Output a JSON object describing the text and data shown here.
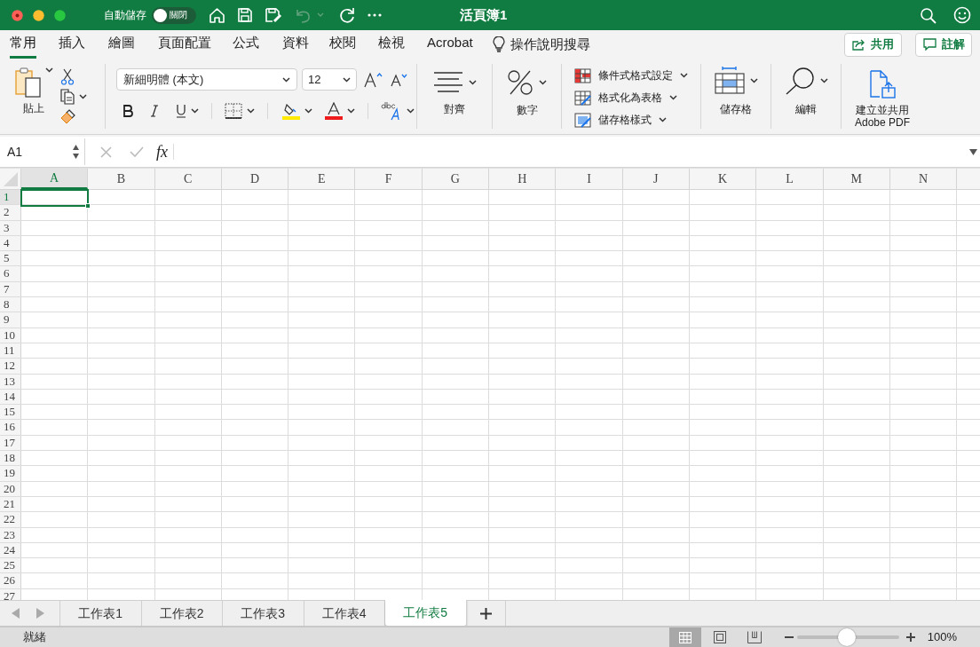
{
  "window": {
    "title": "活頁簿1"
  },
  "autosave": {
    "label": "自動儲存",
    "on": false,
    "state_text": "關閉"
  },
  "undo_disabled": true,
  "ribbon_tabs": [
    {
      "label": "常用",
      "selected": true
    },
    {
      "label": "插入",
      "selected": false
    },
    {
      "label": "繪圖",
      "selected": false
    },
    {
      "label": "頁面配置",
      "selected": false
    },
    {
      "label": "公式",
      "selected": false
    },
    {
      "label": "資料",
      "selected": false
    },
    {
      "label": "校閱",
      "selected": false
    },
    {
      "label": "檢視",
      "selected": false
    },
    {
      "label": "Acrobat",
      "selected": false
    }
  ],
  "tell_me": "操作說明搜尋",
  "share_button": "共用",
  "comments_button": "註解",
  "ribbon": {
    "paste_label": "貼上",
    "font_name": "新細明體 (本文)",
    "font_size": "12",
    "alignment_label": "對齊",
    "number_label": "數字",
    "styles": [
      {
        "kind": "conditional",
        "label": "條件式格式設定"
      },
      {
        "kind": "table",
        "label": "格式化為表格"
      },
      {
        "kind": "cell",
        "label": "儲存格樣式"
      }
    ],
    "cells_label": "儲存格",
    "editing_label": "編輯",
    "pdf_label": [
      "建立並共用",
      "Adobe PDF"
    ]
  },
  "formula_bar": {
    "name_box": "A1",
    "fx": "fx"
  },
  "grid": {
    "columns": [
      {
        "label": "A",
        "selected": true
      },
      {
        "label": "B",
        "selected": false
      },
      {
        "label": "C",
        "selected": false
      },
      {
        "label": "D",
        "selected": false
      },
      {
        "label": "E",
        "selected": false
      },
      {
        "label": "F",
        "selected": false
      },
      {
        "label": "G",
        "selected": false
      },
      {
        "label": "H",
        "selected": false
      },
      {
        "label": "I",
        "selected": false
      },
      {
        "label": "J",
        "selected": false
      },
      {
        "label": "K",
        "selected": false
      },
      {
        "label": "L",
        "selected": false
      },
      {
        "label": "M",
        "selected": false
      },
      {
        "label": "N",
        "selected": false
      }
    ],
    "rows": [
      {
        "label": "1",
        "selected": true
      },
      {
        "label": "2",
        "selected": false
      },
      {
        "label": "3",
        "selected": false
      },
      {
        "label": "4",
        "selected": false
      },
      {
        "label": "5",
        "selected": false
      },
      {
        "label": "6",
        "selected": false
      },
      {
        "label": "7",
        "selected": false
      },
      {
        "label": "8",
        "selected": false
      },
      {
        "label": "9",
        "selected": false
      },
      {
        "label": "10",
        "selected": false
      },
      {
        "label": "11",
        "selected": false
      },
      {
        "label": "12",
        "selected": false
      },
      {
        "label": "13",
        "selected": false
      },
      {
        "label": "14",
        "selected": false
      },
      {
        "label": "15",
        "selected": false
      },
      {
        "label": "16",
        "selected": false
      },
      {
        "label": "17",
        "selected": false
      },
      {
        "label": "18",
        "selected": false
      },
      {
        "label": "19",
        "selected": false
      },
      {
        "label": "20",
        "selected": false
      },
      {
        "label": "21",
        "selected": false
      },
      {
        "label": "22",
        "selected": false
      },
      {
        "label": "23",
        "selected": false
      },
      {
        "label": "24",
        "selected": false
      },
      {
        "label": "25",
        "selected": false
      },
      {
        "label": "26",
        "selected": false
      },
      {
        "label": "27",
        "selected": false
      }
    ]
  },
  "sheet_tabs": [
    {
      "label": "工作表1",
      "selected": false
    },
    {
      "label": "工作表2",
      "selected": false
    },
    {
      "label": "工作表3",
      "selected": false
    },
    {
      "label": "工作表4",
      "selected": false
    },
    {
      "label": "工作表5",
      "selected": true
    }
  ],
  "status_bar": {
    "status": "就緒",
    "views": [
      {
        "kind": "normal",
        "selected": true
      },
      {
        "kind": "page_layout",
        "selected": false
      },
      {
        "kind": "page_break",
        "selected": false
      }
    ],
    "zoom": {
      "level": 0.49,
      "reading": "100%"
    }
  }
}
